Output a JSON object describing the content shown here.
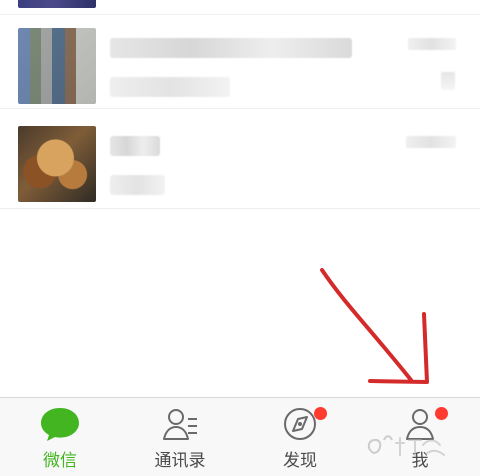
{
  "app": {
    "tabs": [
      {
        "label": "微信",
        "icon": "chat-bubble-icon",
        "active": true,
        "badge": false
      },
      {
        "label": "通讯录",
        "icon": "contacts-icon",
        "active": false,
        "badge": false
      },
      {
        "label": "发现",
        "icon": "compass-icon",
        "active": false,
        "badge": true
      },
      {
        "label": "我",
        "icon": "person-icon",
        "active": false,
        "badge": true
      }
    ]
  },
  "colors": {
    "active_tab": "#42b521",
    "inactive_tab": "#4b4b4b",
    "badge": "#ff3b30",
    "annotation": "#d42a2a"
  },
  "chat_list": [
    {
      "avatar": "blurred-avatar"
    },
    {
      "avatar": "blurred-avatar"
    }
  ]
}
